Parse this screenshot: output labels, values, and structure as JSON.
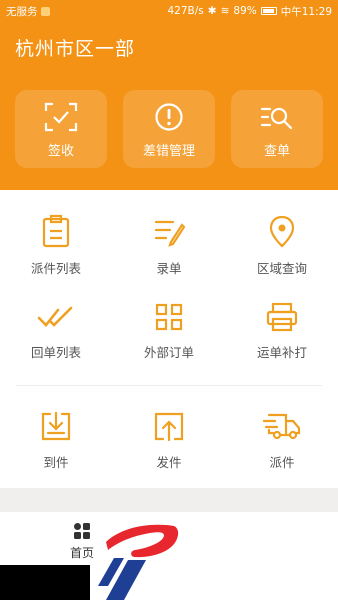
{
  "status_bar": {
    "carrier": "无服务",
    "speed": "427B/s",
    "battery": "89%",
    "time": "中午11:29"
  },
  "header": {
    "title": "杭州市区一部",
    "actions": [
      {
        "label": "签收",
        "icon": "scan-check-icon"
      },
      {
        "label": "差错管理",
        "icon": "alert-circle-icon"
      },
      {
        "label": "查单",
        "icon": "list-search-icon"
      }
    ]
  },
  "grid": {
    "items": [
      {
        "label": "派件列表",
        "icon": "clipboard-icon"
      },
      {
        "label": "录单",
        "icon": "edit-list-icon"
      },
      {
        "label": "区域查询",
        "icon": "location-pin-icon"
      },
      {
        "label": "回单列表",
        "icon": "double-check-icon"
      },
      {
        "label": "外部订单",
        "icon": "qr-code-icon"
      },
      {
        "label": "运单补打",
        "icon": "printer-icon"
      },
      {
        "label": "到件",
        "icon": "inbox-download-icon"
      },
      {
        "label": "发件",
        "icon": "outbox-upload-icon"
      },
      {
        "label": "派件",
        "icon": "delivery-truck-icon"
      }
    ]
  },
  "bottom_nav": {
    "home_label": "首页",
    "home_icon": "grid-home-icon"
  },
  "colors": {
    "brand_orange": "#f39214",
    "icon_orange": "#f0a020",
    "logo_red": "#e8262e",
    "logo_blue": "#1f3f95"
  }
}
